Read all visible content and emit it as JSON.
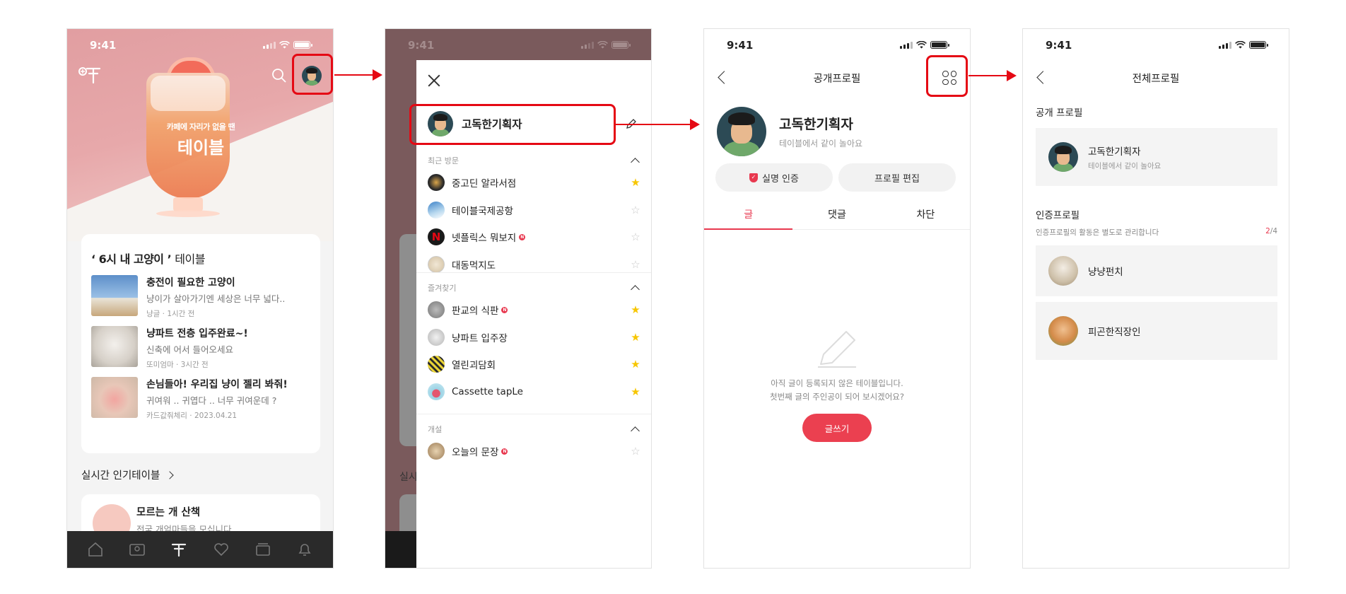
{
  "status": {
    "time": "9:41"
  },
  "home": {
    "hero_sub": "카페에 자리가 없을 땐",
    "hero_title": "테이블",
    "card_title_quote": "‘ 6시 내 고양이 ’",
    "card_title_suffix": "테이블",
    "posts": [
      {
        "title": "충전이 필요한 고양이",
        "body": "냥이가 살아가기엔 세상은 너무 넓다..",
        "meta": "냥글 · 1시간 전"
      },
      {
        "title": "냥파트 전층 입주완료~!",
        "body": "신축에 어서 들어오세요",
        "meta": "또미엄마 · 3시간 전"
      },
      {
        "title": "손님들아! 우리집 냥이 젤리 봐줘!",
        "body": "귀여워 .. 귀엽다 .. 너무 귀여운데 ?",
        "meta": "카드값줘체리 · 2023.04.21"
      }
    ],
    "popular_title": "실시간 인기테이블",
    "popular_card": {
      "title": "모르는 개 산책",
      "sub": "전국 개엄마들을 모십니다."
    }
  },
  "drawer": {
    "user_name": "고독한기획자",
    "recent_label": "최근 방문",
    "recent": [
      {
        "label": "중고딘 알라서점",
        "new": false,
        "starred": true
      },
      {
        "label": "테이블국제공항",
        "new": false,
        "starred": false
      },
      {
        "label": "넷플릭스 뭐보지",
        "new": true,
        "starred": false
      },
      {
        "label": "대동먹지도",
        "new": false,
        "starred": false
      }
    ],
    "favorites_label": "즐겨찾기",
    "favorites": [
      {
        "label": "판교의 식판",
        "new": true,
        "starred": true
      },
      {
        "label": "냥파트 입주장",
        "new": false,
        "starred": true
      },
      {
        "label": "열린괴담회",
        "new": false,
        "starred": true
      },
      {
        "label": "Cassette tapLe",
        "new": false,
        "starred": true
      }
    ],
    "created_label": "개설",
    "created": [
      {
        "label": "오늘의 문장",
        "new": true,
        "starred": false
      }
    ],
    "new_badge": "N"
  },
  "public_profile": {
    "nav_title": "공개프로필",
    "name": "고독한기획자",
    "bio": "테이블에서 같이 놀아요",
    "verify_label": "실명 인증",
    "edit_label": "프로필 편집",
    "tabs": [
      "글",
      "댓글",
      "차단"
    ],
    "empty_line1": "아직 글이 등록되지 않은 테이블입니다.",
    "empty_line2": "첫번째 글의 주인공이 되어 보시겠어요?",
    "write_label": "글쓰기"
  },
  "all_profiles": {
    "nav_title": "전체프로필",
    "public_label": "공개 프로필",
    "public_card": {
      "name": "고독한기획자",
      "bio": "테이블에서 같이 놀아요"
    },
    "verified_label": "인증프로필",
    "verified_sub": "인증프로필의 활동은 별도로 관리합니다",
    "count_current": "2",
    "count_total": "/4",
    "verified": [
      {
        "name": "냥냥펀치"
      },
      {
        "name": "피곤한직장인"
      }
    ]
  },
  "colors": {
    "accent": "#e8384f",
    "highlight": "#e50914",
    "star": "#f7c600"
  }
}
